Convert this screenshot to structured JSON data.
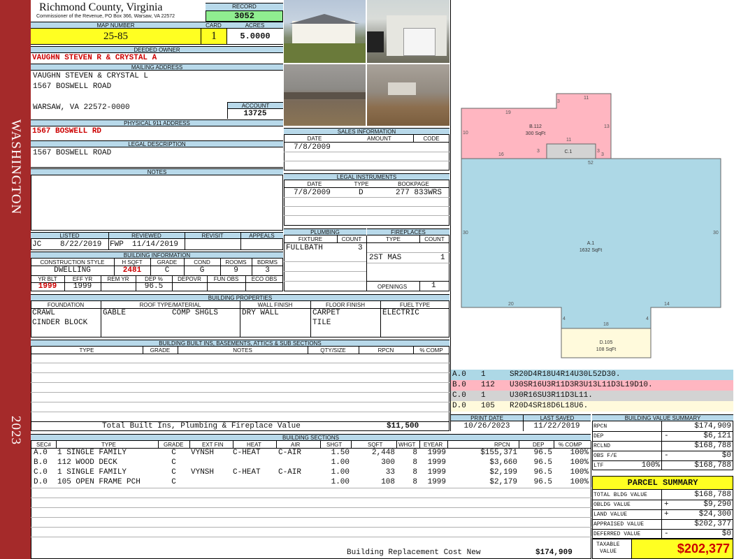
{
  "side": {
    "county_word": "WASHINGTON",
    "year": "2023"
  },
  "header": {
    "title": "Richmond County, Virginia",
    "address": "Commissioner of the Revenue, PO Box 366, Warsaw, VA 22572",
    "record_label": "RECORD",
    "record": "3052",
    "map_label": "MAP NUMBER",
    "map": "25-85",
    "card_label": "CARD",
    "card": "1",
    "acres_label": "ACRES",
    "acres": "5.0000"
  },
  "owner": {
    "label": "DEEDED OWNER",
    "value": "VAUGHN STEVEN R & CRYSTAL A",
    "mail_label": "MAILING ADDRESS",
    "mail_line1": "VAUGHN STEVEN & CRYSTAL L",
    "mail_line2": "1567 BOSWELL ROAD",
    "mail_line3": "WARSAW, VA 22572-0000",
    "account_label": "ACCOUNT",
    "account": "13725"
  },
  "physical": {
    "label": "PHYSICAL 911 ADDRESS",
    "value": "1567 BOSWELL RD"
  },
  "legal": {
    "label": "LEGAL DESCRIPTION",
    "value": "1567 BOSWELL ROAD"
  },
  "notes": {
    "label": "NOTES"
  },
  "sales": {
    "label": "SALES INFORMATION",
    "cols": [
      "DATE",
      "AMOUNT",
      "CODE"
    ],
    "row_date": "7/8/2009"
  },
  "instruments": {
    "label": "LEGAL INSTRUMENTS",
    "cols": [
      "DATE",
      "TYPE",
      "BOOKPAGE"
    ],
    "row_date": "7/8/2009",
    "row_type": "D",
    "row_book": "277 833WRS"
  },
  "plumbing": {
    "label": "PLUMBING",
    "cols": [
      "FIXTURE",
      "COUNT"
    ],
    "fixture": "FULLBATH",
    "count": "3"
  },
  "fireplaces": {
    "label": "FIREPLACES",
    "cols": [
      "TYPE",
      "COUNT"
    ],
    "type": "2ST MAS",
    "count": "1",
    "openings_label": "OPENINGS",
    "openings": "1"
  },
  "review": {
    "labels": [
      "LISTED",
      "REVIEWED",
      "REVISIT",
      "APPEALS"
    ],
    "listed_by": "JC",
    "listed_date": "8/22/2019",
    "reviewed_by": "FWP",
    "reviewed_date": "11/14/2019"
  },
  "building_info": {
    "label": "BUILDING INFORMATION",
    "cols1": [
      "CONSTRUCTION STYLE",
      "H SQFT",
      "GRADE",
      "COND",
      "ROOMS",
      "BDRMS"
    ],
    "style": "DWELLING",
    "hsqft": "2481",
    "grade": "C",
    "cond": "G",
    "rooms": "9",
    "bdrms": "3",
    "cols2": [
      "YR BLT",
      "EFF YR",
      "REM YR",
      "DEP %",
      "DEPOVR",
      "FUN OBS",
      "ECO OBS"
    ],
    "yrblt": "1999",
    "effyr": "1999",
    "dep": "96.5"
  },
  "properties": {
    "label": "BUILDING PROPERTIES",
    "cols": [
      "FOUNDATION",
      "ROOF TYPE/MATERIAL",
      "WALL FINISH",
      "FLOOR FINISH",
      "FUEL TYPE"
    ],
    "foundation1": "CRAWL",
    "foundation2": "CINDER BLOCK",
    "roof1": "GABLE",
    "roof2": "COMP SHGLS",
    "wall": "DRY WALL",
    "floor1": "CARPET",
    "floor2": "TILE",
    "fuel": "ELECTRIC"
  },
  "builtins": {
    "label": "BUILDING BUILT INS, BASEMENTS, ATTICS & SUB SECTIONS",
    "cols": [
      "TYPE",
      "GRADE",
      "NOTES",
      "QTY/SIZE",
      "RPCN",
      "% COMP"
    ],
    "total_label": "Total Built Ins, Plumbing & Fireplace Value",
    "total": "$11,500"
  },
  "sketch": {
    "a_label": "A.1",
    "a_area": "1632 SqFt",
    "b_label": "B.112",
    "b_area": "300 SqFt",
    "c_label": "C.1",
    "d_label": "D.105",
    "d_area": "108 SqFt",
    "dims": [
      "11",
      "3",
      "19",
      "13",
      "10",
      "16",
      "3",
      "11",
      "3",
      "3",
      "52",
      "30",
      "30",
      "20",
      "14",
      "4",
      "18",
      "4"
    ],
    "colors": {
      "a": "#add8e6",
      "b": "#ffb6c1",
      "c": "#d3d3d3",
      "d": "#fffadc"
    }
  },
  "traverse": [
    {
      "sec": "A.0",
      "code": "1",
      "path": "SR20D4R18U4R14U30L52D30."
    },
    {
      "sec": "B.0",
      "code": "112",
      "path": "U30SR16U3R11D3R3U13L11D3L19D10."
    },
    {
      "sec": "C.0",
      "code": "1",
      "path": "U30R16SU3R11D3L11."
    },
    {
      "sec": "D.0",
      "code": "105",
      "path": "R20D4SR18D6L18U6."
    }
  ],
  "dates": {
    "print_label": "PRINT DATE",
    "print": "10/26/2023",
    "saved_label": "LAST SAVED",
    "saved": "11/22/2019"
  },
  "sections": {
    "label": "BUILDING SECTIONS",
    "cols": [
      "SEC#",
      "TYPE",
      "GRADE",
      "EXT FIN",
      "HEAT",
      "AIR",
      "SHGT",
      "SQFT",
      "WHGT",
      "EYEAR",
      "RPCN",
      "DEP",
      "% COMP"
    ],
    "rows": [
      [
        "A.0",
        "1 SINGLE FAMILY",
        "C",
        "VYNSH",
        "C-HEAT",
        "C-AIR",
        "1.50",
        "2,448",
        "8",
        "1999",
        "$155,371",
        "96.5",
        "100%"
      ],
      [
        "B.0",
        "112 WOOD DECK",
        "C",
        "",
        "",
        "",
        "1.00",
        "300",
        "8",
        "1999",
        "$3,660",
        "96.5",
        "100%"
      ],
      [
        "C.0",
        "1 SINGLE FAMILY",
        "C",
        "VYNSH",
        "C-HEAT",
        "C-AIR",
        "1.00",
        "33",
        "8",
        "1999",
        "$2,199",
        "96.5",
        "100%"
      ],
      [
        "D.0",
        "105 OPEN FRAME PCH",
        "C",
        "",
        "",
        "",
        "1.00",
        "108",
        "8",
        "1999",
        "$2,179",
        "96.5",
        "100%"
      ]
    ],
    "replacement_label": "Building Replacement Cost New",
    "replacement": "$174,909"
  },
  "value_summary": {
    "label": "BUILDING VALUE SUMMARY",
    "rows": [
      [
        "RPCN",
        "",
        "$174,909"
      ],
      [
        "DEP",
        "-",
        "$6,121"
      ],
      [
        "RCLND",
        "",
        "$168,788"
      ],
      [
        "OBS F/E",
        "-",
        "$0"
      ],
      [
        "LTF",
        "100%",
        "$168,788"
      ]
    ]
  },
  "parcel": {
    "label": "PARCEL SUMMARY",
    "rows": [
      [
        "TOTAL BLDG VALUE",
        "",
        "$168,788"
      ],
      [
        "OBLDG VALUE",
        "+",
        "$9,290"
      ],
      [
        "LAND VALUE",
        "+",
        "$24,300"
      ],
      [
        "APPRAISED VALUE",
        "",
        "$202,377"
      ],
      [
        "DEFERRED VALUE",
        "-",
        "$0"
      ]
    ],
    "taxable_label1": "TAXABLE",
    "taxable_label2": "VALUE",
    "taxable": "$202,377"
  }
}
